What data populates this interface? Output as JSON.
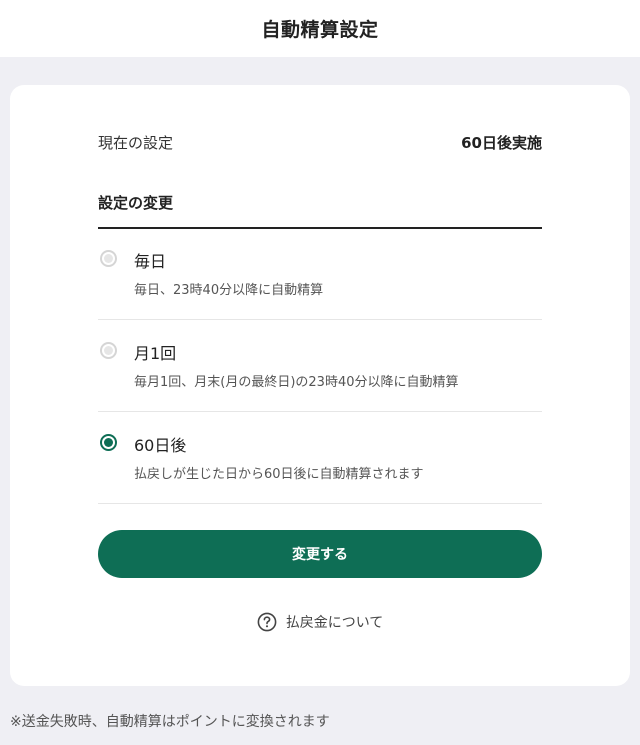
{
  "header": {
    "title": "自動精算設定"
  },
  "current_setting": {
    "label": "現在の設定",
    "value": "60日後実施"
  },
  "change_section": {
    "heading": "設定の変更",
    "options": [
      {
        "title": "毎日",
        "description": "毎日、23時40分以降に自動精算",
        "selected": false
      },
      {
        "title": "月1回",
        "description": "毎月1回、月末(月の最終日)の23時40分以降に自動精算",
        "selected": false
      },
      {
        "title": "60日後",
        "description": "払戻しが生じた日から60日後に自動精算されます",
        "selected": true
      }
    ]
  },
  "submit_button": {
    "label": "変更する"
  },
  "help_link": {
    "icon": "question-circle-icon",
    "label": "払戻金について"
  },
  "footer": {
    "note": "※送金失敗時、自動精算はポイントに変換されます"
  },
  "colors": {
    "accent": "#0e6e55",
    "background": "#efeff4",
    "card": "#ffffff",
    "text": "#222222",
    "muted_text": "#555555",
    "radio_disabled": "#d5d5d5"
  }
}
